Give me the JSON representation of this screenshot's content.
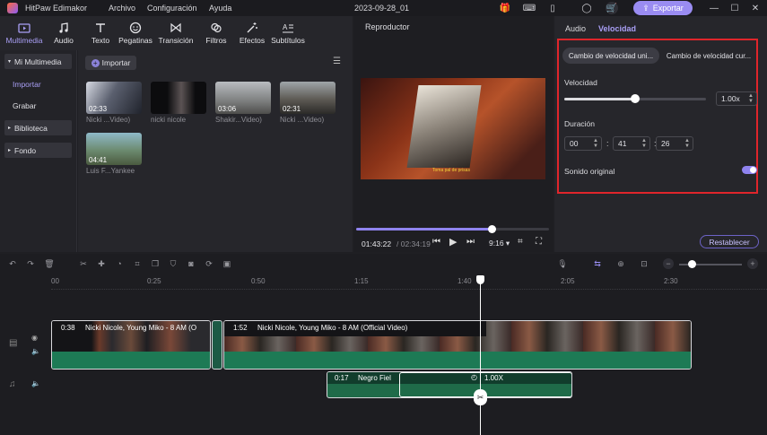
{
  "app": {
    "name": "HitPaw Edimakor",
    "project_title": "2023-09-28_01"
  },
  "menu": [
    "Archivo",
    "Configuración",
    "Ayuda"
  ],
  "export_label": "Exportar",
  "toolbar": {
    "tabs": [
      {
        "label": "Multimedia",
        "icon": "media-icon",
        "active": true
      },
      {
        "label": "Audio",
        "icon": "music-note-icon"
      },
      {
        "label": "Texto",
        "icon": "text-icon"
      },
      {
        "label": "Pegatinas",
        "icon": "sticker-icon"
      },
      {
        "label": "Transición",
        "icon": "transition-icon"
      },
      {
        "label": "Filtros",
        "icon": "filter-icon"
      },
      {
        "label": "Efectos",
        "icon": "effects-icon"
      },
      {
        "label": "Subtítulos",
        "icon": "subtitles-icon"
      }
    ]
  },
  "sidebar": {
    "section": "Mi Multimedia",
    "items": [
      "Importar",
      "Grabar"
    ],
    "groups": [
      "Biblioteca",
      "Fondo"
    ]
  },
  "media": {
    "import_label": "Importar",
    "clips": [
      {
        "duration": "02:33",
        "caption": "Nicki ...Video)"
      },
      {
        "duration": "",
        "caption": "nicki nicole"
      },
      {
        "duration": "03:06",
        "caption": "Shakir...Video)"
      },
      {
        "duration": "02:31",
        "caption": "Nicki ...Video)"
      },
      {
        "duration": "04:41",
        "caption": "Luis F...Yankee"
      }
    ]
  },
  "player": {
    "title": "Reproductor",
    "subtitle_text": "Toma pal de prisas",
    "current_time": "01:43:22",
    "total_time": "/ 02:34:19",
    "aspect": "9:16",
    "progress": 0.7
  },
  "inspector": {
    "tabs": [
      "Audio",
      "Velocidad"
    ],
    "active_tab": "Velocidad",
    "modes": [
      "Cambio de velocidad uni...",
      "Cambio de velocidad cur..."
    ],
    "speed_label": "Velocidad",
    "speed_value": "1.00x",
    "speed_slider": 0.5,
    "duration_label": "Duración",
    "duration": [
      "00",
      "41",
      "26"
    ],
    "original_sound_label": "Sonido original",
    "original_sound_on": true,
    "reset_label": "Restablecer",
    "highlight_color": "#e0252b"
  },
  "timeline": {
    "ruler": [
      "00",
      "0:25",
      "0:50",
      "1:15",
      "1:40",
      "2:05",
      "2:30"
    ],
    "video_clips": [
      {
        "time": "0:38",
        "title": "Nicki Nicole, Young Miko - 8 AM (O"
      },
      {
        "time": "1:52",
        "title": "Nicki Nicole, Young Miko - 8 AM (Official Video)"
      }
    ],
    "audio_clip": {
      "time": "0:17",
      "title": "Negro Fiel",
      "speed": "1.00X"
    }
  },
  "colors": {
    "accent": "#9a8cf2",
    "clip_green": "#1d7a55",
    "audio_green": "#1f6b49"
  }
}
